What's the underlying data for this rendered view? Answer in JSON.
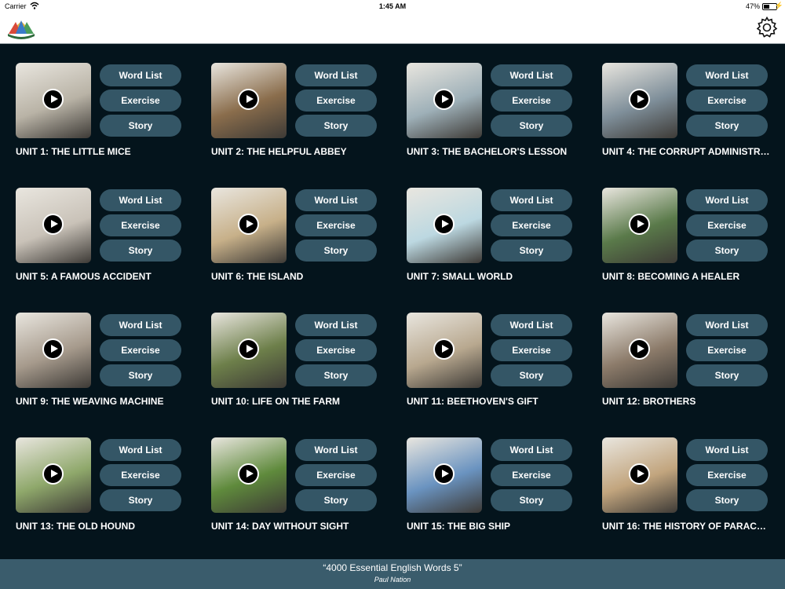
{
  "status_bar": {
    "carrier": "Carrier",
    "time": "1:45 AM",
    "battery": "47%",
    "battery_level": 0.47
  },
  "nav": {
    "logo_icon": "fan-book-logo-icon",
    "settings_icon": "gear-icon"
  },
  "buttons": {
    "word_list": "Word List",
    "exercise": "Exercise",
    "story": "Story"
  },
  "units": [
    {
      "title": "UNIT 1: THE LITTLE MICE",
      "thumb_color": "#b9b3a6"
    },
    {
      "title": "UNIT 2: THE HELPFUL ABBEY",
      "thumb_color": "#8a6d4c"
    },
    {
      "title": "UNIT 3: THE BACHELOR'S LESSON",
      "thumb_color": "#9eb0b8"
    },
    {
      "title": "UNIT 4: THE CORRUPT ADMINISTR…",
      "thumb_color": "#7f8f9a"
    },
    {
      "title": "UNIT 5: A FAMOUS ACCIDENT",
      "thumb_color": "#c9c2b8"
    },
    {
      "title": "UNIT 6: THE ISLAND",
      "thumb_color": "#c7b089"
    },
    {
      "title": "UNIT 7: SMALL WORLD",
      "thumb_color": "#bcd8e1"
    },
    {
      "title": "UNIT 8: BECOMING A HEALER",
      "thumb_color": "#5a7a4a"
    },
    {
      "title": "UNIT 9: THE WEAVING MACHINE",
      "thumb_color": "#a69a8c"
    },
    {
      "title": "UNIT 10: LIFE ON THE FARM",
      "thumb_color": "#6d7f4a"
    },
    {
      "title": "UNIT 11: BEETHOVEN'S GIFT",
      "thumb_color": "#b8a88f"
    },
    {
      "title": "UNIT 12: BROTHERS",
      "thumb_color": "#8c7b6a"
    },
    {
      "title": "UNIT 13: THE OLD HOUND",
      "thumb_color": "#8fa86b"
    },
    {
      "title": "UNIT 14: DAY WITHOUT SIGHT",
      "thumb_color": "#5f8a3c"
    },
    {
      "title": "UNIT 15: THE BIG SHIP",
      "thumb_color": "#6a93c0"
    },
    {
      "title": "UNIT 16: THE HISTORY OF PARAC…",
      "thumb_color": "#c2a57e"
    }
  ],
  "footer": {
    "title": "“4000 Essential English Words 5”",
    "author": "Paul Nation"
  }
}
